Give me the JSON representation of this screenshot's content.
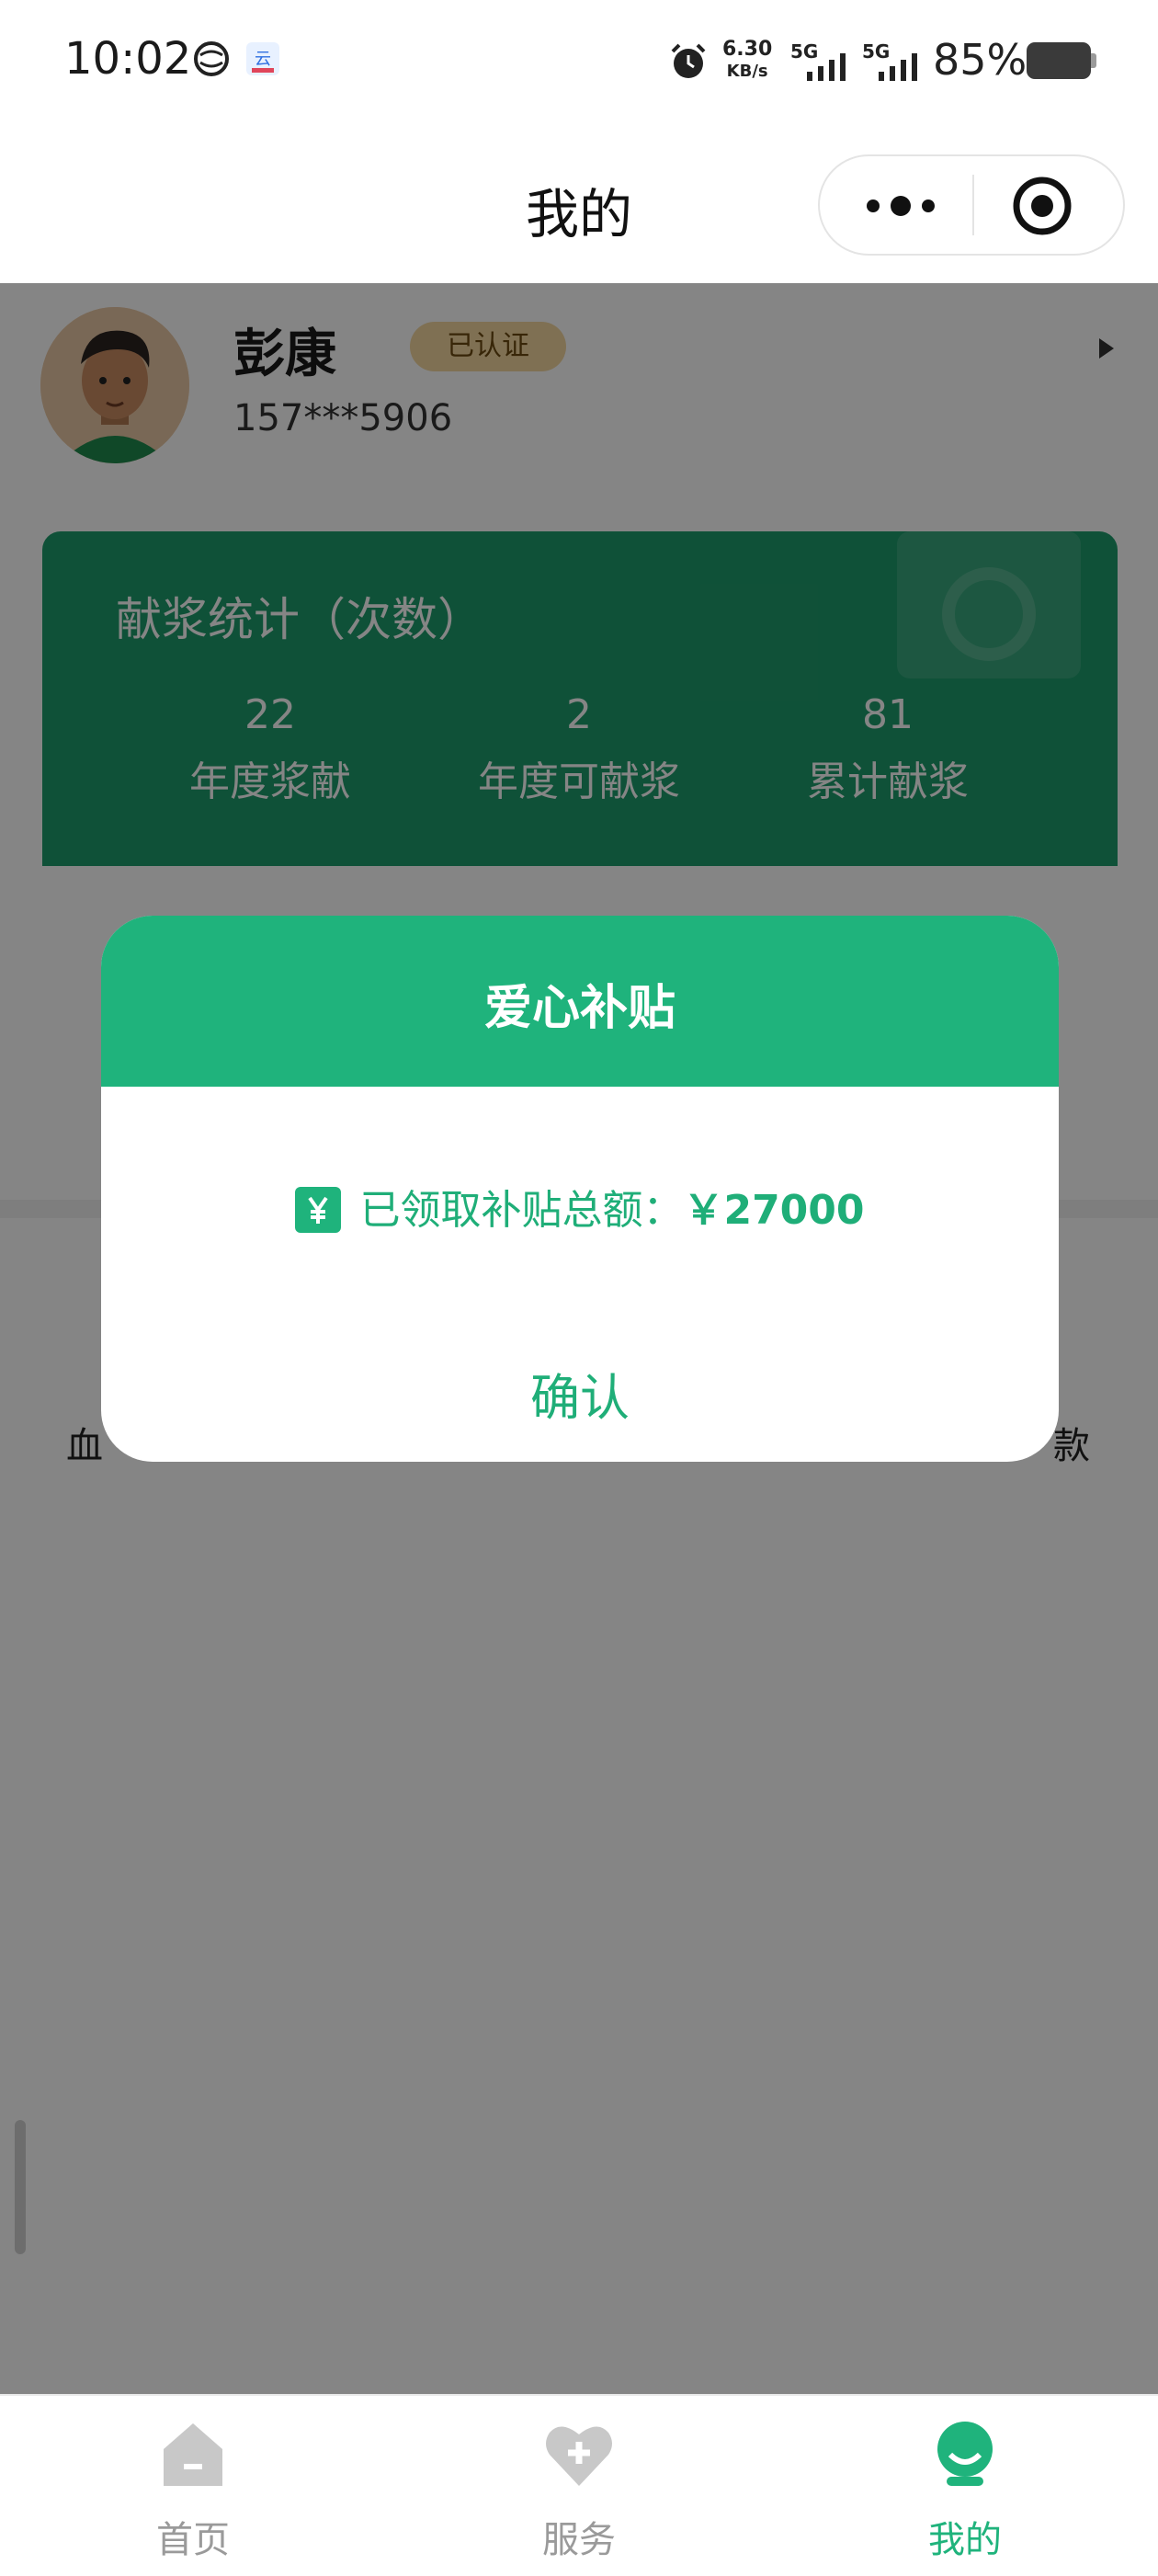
{
  "status_bar": {
    "time": "10:02",
    "net_speed_value": "6.30",
    "net_speed_unit": "KB/s",
    "signal_1": "5G",
    "signal_2": "5G",
    "battery": "85%",
    "icons": [
      "carrier-icon",
      "app-notification-icon",
      "alarm-icon",
      "signal-icon",
      "battery-icon"
    ]
  },
  "navbar": {
    "title": "我的",
    "capsule_icons": [
      "more-icon",
      "close-target-icon"
    ]
  },
  "profile": {
    "name": "彭康",
    "badge": "已认证",
    "phone": "157***5906"
  },
  "stats": {
    "title": "献浆统计（次数）",
    "items": [
      {
        "value": "22",
        "label": "年度浆献"
      },
      {
        "value": "2",
        "label": "年度可献浆"
      },
      {
        "value": "81",
        "label": "累计献浆"
      }
    ]
  },
  "background_text": {
    "left": "血",
    "right": "款"
  },
  "modal": {
    "title": "爱心补贴",
    "body_label": "已领取补贴总额：",
    "amount": "￥27000",
    "confirm": "确认"
  },
  "tabbar": {
    "items": [
      {
        "label": "首页",
        "icon": "home-icon",
        "active": false
      },
      {
        "label": "服务",
        "icon": "heart-plus-icon",
        "active": false
      },
      {
        "label": "我的",
        "icon": "user-icon",
        "active": true
      }
    ]
  },
  "colors": {
    "accent": "#1fb37c",
    "stats_card": "#1e9c6c",
    "badge": "#f3d6a0",
    "tab_inactive": "#9a9a9a"
  }
}
